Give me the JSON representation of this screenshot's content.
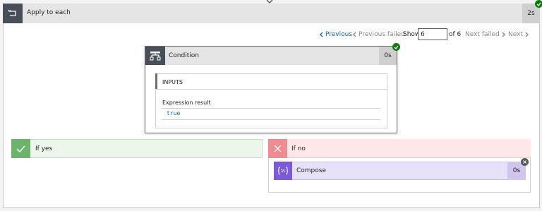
{
  "apply_to_each": {
    "title": "Apply to each",
    "duration": "2s",
    "status": "succeeded"
  },
  "pager": {
    "previous": "Previous",
    "previous_failed": "Previous failed",
    "show_label": "Show",
    "current": "6",
    "of_total": "of 6",
    "next_failed": "Next failed",
    "next": "Next"
  },
  "condition": {
    "title": "Condition",
    "duration": "0s",
    "status": "succeeded",
    "inputs_label": "INPUTS",
    "expression_label": "Expression result",
    "expression_value": "true"
  },
  "if_yes": {
    "label": "If yes"
  },
  "if_no": {
    "label": "If no",
    "compose": {
      "title": "Compose",
      "duration": "0s",
      "status": "skipped"
    }
  },
  "colors": {
    "success": "#0e7a0d",
    "link": "#0f6cbd",
    "yes_bg": "#ecf6eb",
    "no_bg": "#fde7e9",
    "compose": "#7a5bd5"
  }
}
